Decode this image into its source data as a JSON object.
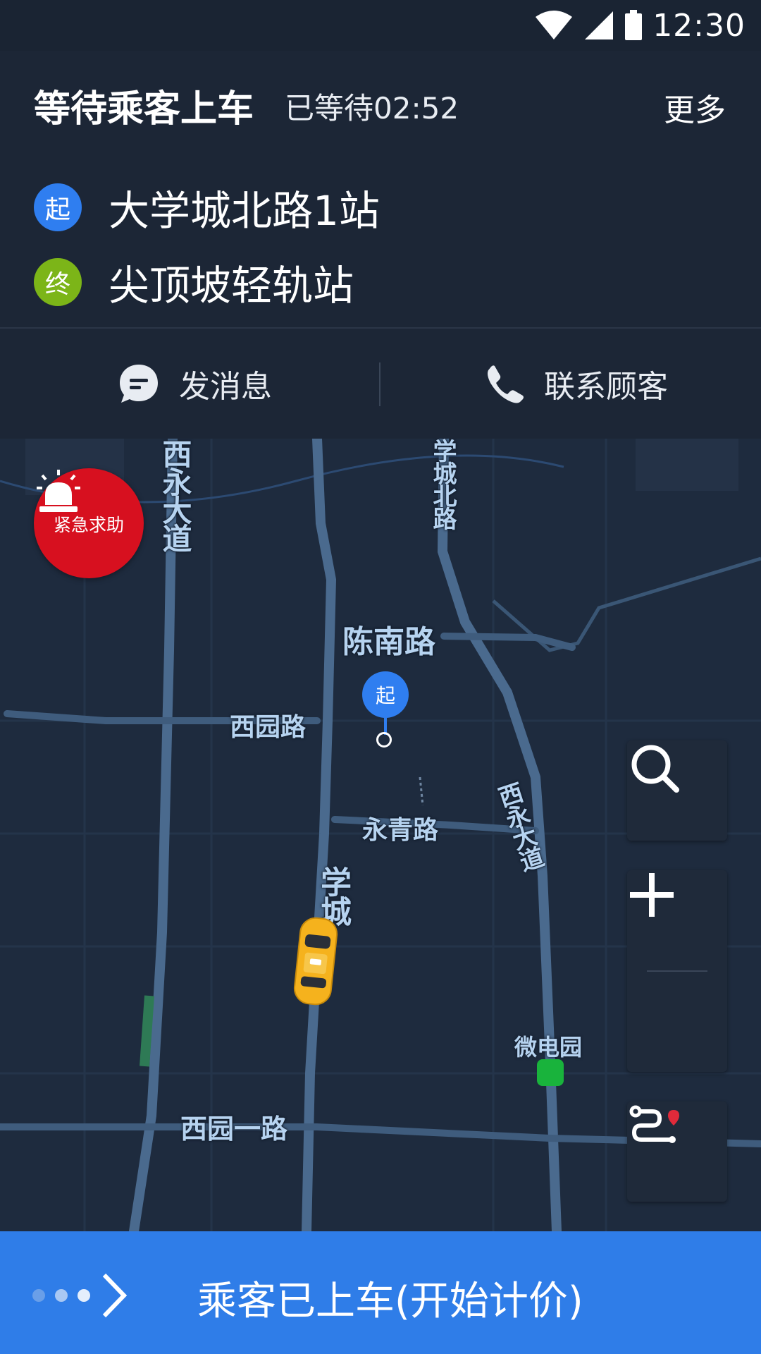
{
  "status_bar": {
    "time": "12:30"
  },
  "header": {
    "title": "等待乘客上车",
    "wait_text": "已等待02:52",
    "more_label": "更多"
  },
  "route": {
    "start": {
      "badge": "起",
      "name": "大学城北路1站",
      "color": "#2f7ef0"
    },
    "end": {
      "badge": "终",
      "name": "尖顶坡轻轨站",
      "color": "#7cb518"
    }
  },
  "actions": {
    "message_label": "发消息",
    "contact_label": "联系顾客"
  },
  "map": {
    "sos_label": "紧急求助",
    "start_pin": "起",
    "roads": {
      "xiyong": "西永大道",
      "daxuecheng_north": "学城北路",
      "chennan": "陈南路",
      "xiyuan": "西园路",
      "yongqing": "永青路",
      "xiyong2": "西永大道",
      "daxuecheng": "学城",
      "xiyuan1": "西园一路"
    },
    "poi": "微电园"
  },
  "bottom": {
    "label": "乘客已上车(开始计价)"
  },
  "colors": {
    "accent": "#2f7de8",
    "sos": "#d7101f",
    "map_bg": "#1e2b3e"
  }
}
